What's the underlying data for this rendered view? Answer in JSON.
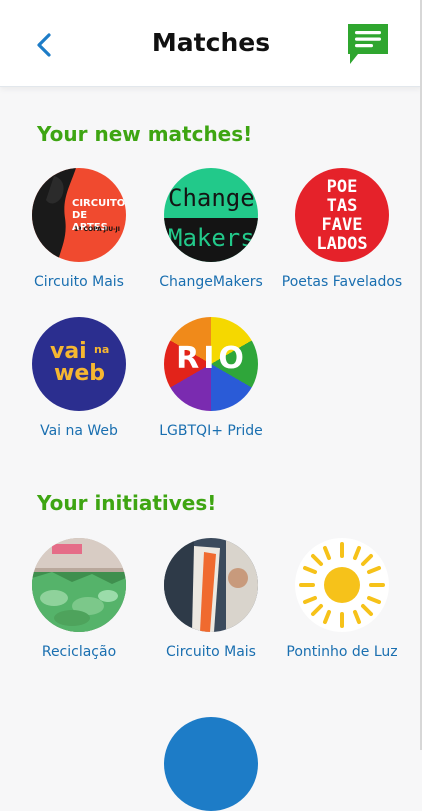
{
  "header": {
    "title": "Matches"
  },
  "sections": {
    "new_matches": {
      "title": "Your new matches!",
      "items": [
        {
          "label": "Circuito Mais",
          "avatar_text": "CIRCUITO DE ARTES",
          "avatar_subtext": "1ª COPA JIU-JI"
        },
        {
          "label": "ChangeMakers",
          "avatar_text": "Change",
          "avatar_subtext": "Makers"
        },
        {
          "label": "Poetas Favelados",
          "avatar_text": "POE TAS FAVE LADOS"
        },
        {
          "label": "Vai na Web",
          "avatar_text": "vai",
          "avatar_small": "na",
          "avatar_subtext": "web"
        },
        {
          "label": "LGBTQI+ Pride",
          "avatar_text": "RIO"
        }
      ]
    },
    "initiatives": {
      "title": "Your initiatives!",
      "items": [
        {
          "label": "Reciclação"
        },
        {
          "label": "Circuito Mais"
        },
        {
          "label": "Pontinho de Luz"
        }
      ]
    }
  },
  "colors": {
    "accent_green": "#3ea512",
    "link_blue": "#1a6fb0",
    "back_blue": "#1d7cc7",
    "chat_green": "#2fa62f"
  },
  "icons": {
    "back": "chevron-left-icon",
    "chat": "chat-icon"
  }
}
